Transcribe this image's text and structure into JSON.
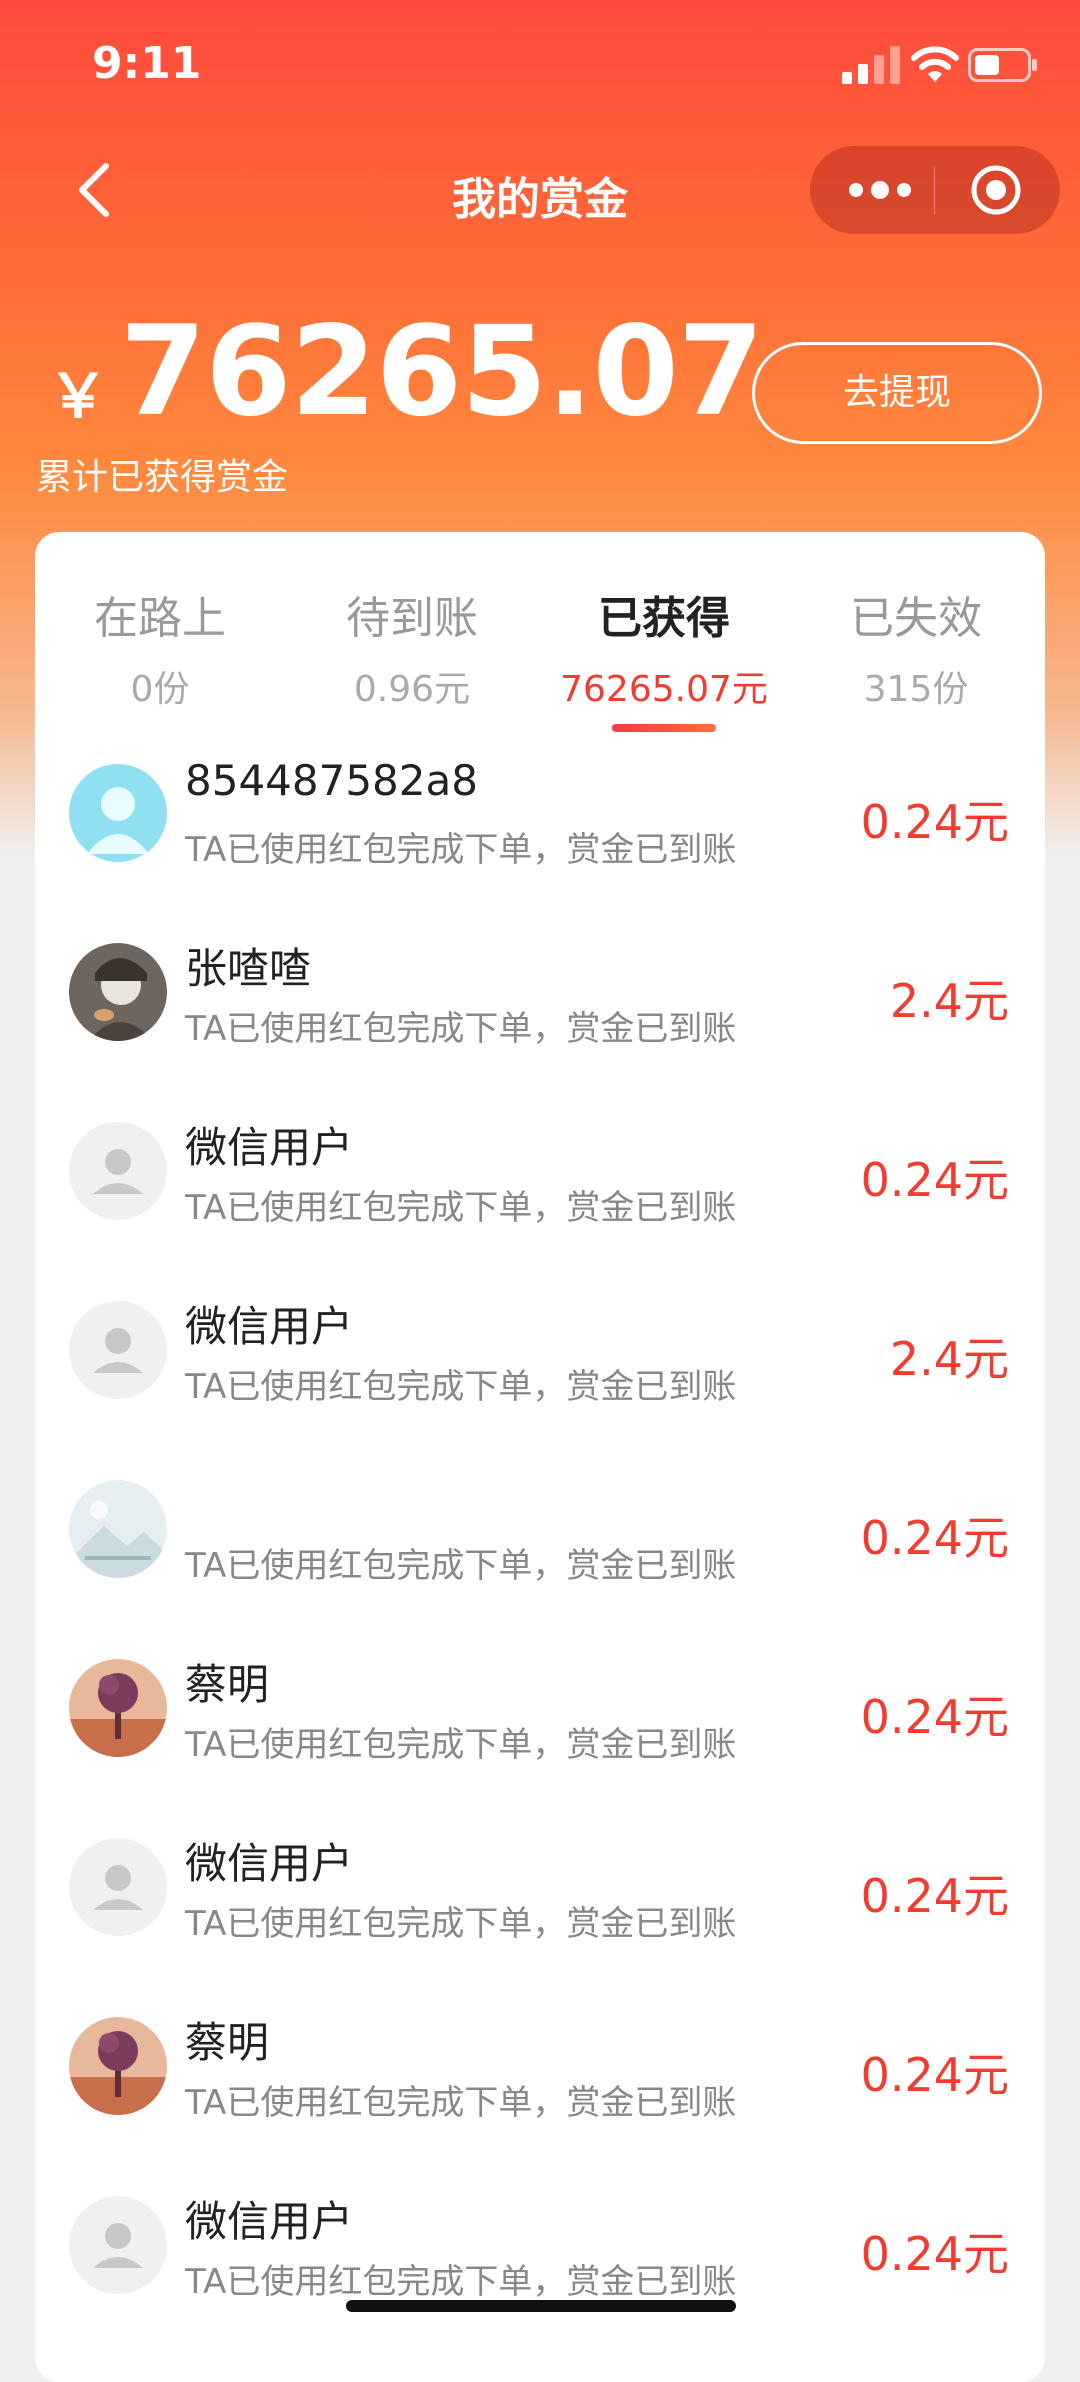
{
  "status_bar": {
    "time": "9:11"
  },
  "nav": {
    "title": "我的赏金"
  },
  "summary": {
    "currency": "￥",
    "total": "76265.07",
    "subtitle": "累计已获得赏金",
    "withdraw_label": "去提现"
  },
  "tabs": [
    {
      "label": "在路上",
      "sub": "0份",
      "active": false
    },
    {
      "label": "待到账",
      "sub": "0.96元",
      "active": false
    },
    {
      "label": "已获得",
      "sub": "76265.07元",
      "active": true
    },
    {
      "label": "已失效",
      "sub": "315份",
      "active": false
    }
  ],
  "records": [
    {
      "name": "854487582a8",
      "desc": "TA已使用红包完成下单，赏金已到账",
      "amount": "0.24元",
      "avatar": "light-blue-person"
    },
    {
      "name": "张喳喳",
      "desc": "TA已使用红包完成下单，赏金已到账",
      "amount": "2.4元",
      "avatar": "photo-person"
    },
    {
      "name": "微信用户",
      "desc": "TA已使用红包完成下单，赏金已到账",
      "amount": "0.24元",
      "avatar": "default-gray"
    },
    {
      "name": "微信用户",
      "desc": "TA已使用红包完成下单，赏金已到账",
      "amount": "2.4元",
      "avatar": "default-gray"
    },
    {
      "name": "",
      "desc": "TA已使用红包完成下单，赏金已到账",
      "amount": "0.24元",
      "avatar": "image-placeholder"
    },
    {
      "name": "蔡明",
      "desc": "TA已使用红包完成下单，赏金已到账",
      "amount": "0.24元",
      "avatar": "tree-sunset"
    },
    {
      "name": "微信用户",
      "desc": "TA已使用红包完成下单，赏金已到账",
      "amount": "0.24元",
      "avatar": "default-gray"
    },
    {
      "name": "蔡明",
      "desc": "TA已使用红包完成下单，赏金已到账",
      "amount": "0.24元",
      "avatar": "tree-sunset"
    },
    {
      "name": "微信用户",
      "desc": "TA已使用红包完成下单，赏金已到账",
      "amount": "0.24元",
      "avatar": "default-gray"
    }
  ],
  "colors": {
    "accent": "#f23c2f",
    "header_top": "#ff4a3d",
    "header_mid": "#ff8a3e"
  }
}
